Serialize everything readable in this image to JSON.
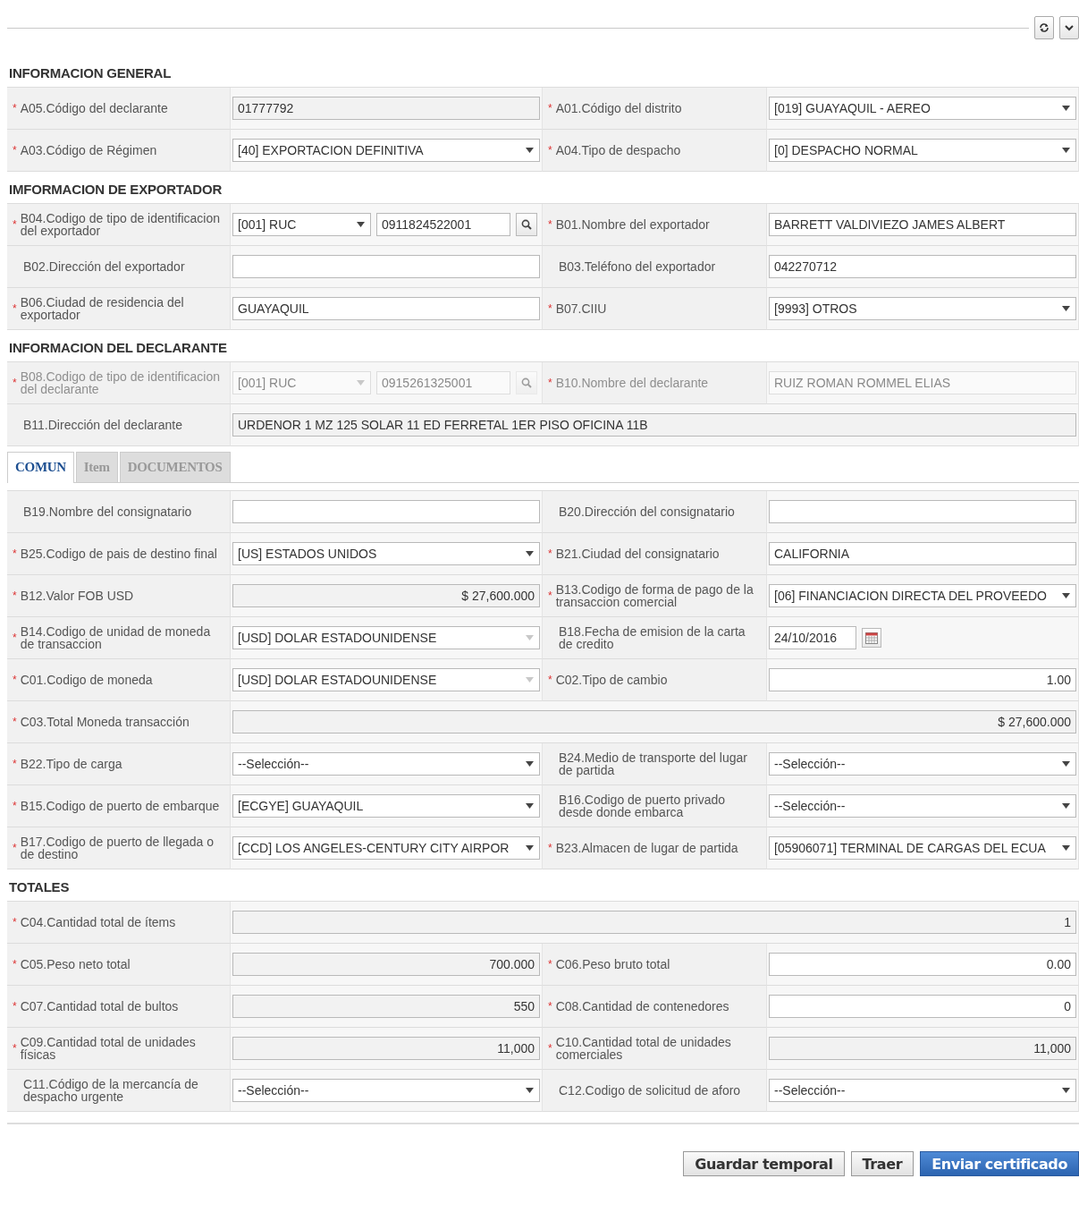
{
  "sections": [
    {
      "title": "INFORMACION GENERAL",
      "rows": [
        {
          "cells": [
            {
              "mark": "*",
              "label": "A05.Código del declarante",
              "field": {
                "kind": "text",
                "value": "01777792",
                "readonly": true
              }
            },
            {
              "mark": "*",
              "label": "A01.Código del distrito",
              "field": {
                "kind": "select",
                "value": "[019] GUAYAQUIL - AEREO"
              }
            }
          ]
        },
        {
          "cells": [
            {
              "mark": "*",
              "label": "A03.Código de Régimen",
              "field": {
                "kind": "select",
                "value": "[40] EXPORTACION DEFINITIVA"
              }
            },
            {
              "mark": "*",
              "label": "A04.Tipo de despacho",
              "field": {
                "kind": "select",
                "value": "[0] DESPACHO NORMAL"
              }
            }
          ]
        }
      ]
    },
    {
      "title": "IMFORMACION DE EXPORTADOR",
      "rows": [
        {
          "cells": [
            {
              "mark": "*",
              "label": "B04.Codigo de tipo de identificacion del exportador",
              "field": {
                "kind": "id",
                "option": "[001] RUC",
                "value": "0911824522001"
              }
            },
            {
              "mark": "*",
              "label": "B01.Nombre del exportador",
              "field": {
                "kind": "text",
                "value": "BARRETT VALDIVIEZO JAMES ALBERT"
              }
            }
          ]
        },
        {
          "cells": [
            {
              "label": "B02.Dirección del exportador",
              "field": {
                "kind": "text"
              }
            },
            {
              "label": "B03.Teléfono del exportador",
              "field": {
                "kind": "text",
                "value": "042270712"
              }
            }
          ]
        },
        {
          "cells": [
            {
              "mark": "*",
              "label": "B06.Ciudad de residencia del exportador",
              "field": {
                "kind": "text",
                "value": "GUAYAQUIL"
              }
            },
            {
              "mark": "*",
              "label": "B07.CIIU",
              "field": {
                "kind": "select",
                "value": "[9993] OTROS"
              }
            }
          ]
        }
      ]
    },
    {
      "title": "INFORMACION DEL DECLARANTE",
      "rows": [
        {
          "cells": [
            {
              "mark": "*",
              "label": "B08.Codigo de tipo de identificacion del declarante",
              "disabled": true,
              "field": {
                "kind": "id",
                "option": "[001] RUC",
                "value": "0915261325001",
                "disabled": true
              }
            },
            {
              "mark": "*",
              "label": "B10.Nombre del declarante",
              "disabled": true,
              "field": {
                "kind": "text",
                "value": "RUIZ ROMAN ROMMEL ELIAS",
                "disabled": true
              }
            }
          ]
        },
        {
          "cells": [
            {
              "label": "B11.Dirección del declarante",
              "wide": true,
              "field": {
                "kind": "text",
                "value": "URDENOR 1 MZ 125 SOLAR 11 ED FERRETAL 1ER PISO OFICINA 11B",
                "readonly": true
              }
            }
          ]
        }
      ]
    }
  ],
  "tabs": [
    {
      "label": "COMUN",
      "selected": true
    },
    {
      "label": "Item",
      "selected": false
    },
    {
      "label": "DOCUMENTOS",
      "selected": false
    }
  ],
  "tab_sections": [
    {
      "rows": [
        {
          "cells": [
            {
              "label": "B19.Nombre del consignatario",
              "field": {
                "kind": "text"
              }
            },
            {
              "label": "B20.Dirección del consignatario",
              "field": {
                "kind": "text"
              }
            }
          ]
        },
        {
          "cells": [
            {
              "mark": "*",
              "label": "B25.Codigo de pais de destino final",
              "field": {
                "kind": "select",
                "value": "[US] ESTADOS UNIDOS"
              }
            },
            {
              "mark": "*",
              "label": "B21.Ciudad del consignatario",
              "field": {
                "kind": "text",
                "value": "CALIFORNIA"
              }
            }
          ]
        },
        {
          "cells": [
            {
              "mark": "*",
              "label": "B12.Valor FOB USD",
              "field": {
                "kind": "number",
                "value": "$ 27,600.000",
                "readonly": true
              }
            },
            {
              "mark": "*",
              "label": "B13.Codigo de forma de pago de la transaccion comercial",
              "field": {
                "kind": "select",
                "value": "[06] FINANCIACION DIRECTA DEL PROVEEDO"
              }
            }
          ]
        },
        {
          "cells": [
            {
              "mark": "*",
              "label": "B14.Codigo de unidad de moneda de transaccion",
              "field": {
                "kind": "select",
                "value": "[USD] DOLAR ESTADOUNIDENSE",
                "readonly": true
              }
            },
            {
              "label": "B18.Fecha de emision de la carta de credito",
              "field": {
                "kind": "date",
                "value": "24/10/2016"
              }
            }
          ]
        },
        {
          "cells": [
            {
              "mark": "*",
              "label": "C01.Codigo de moneda",
              "field": {
                "kind": "select",
                "value": "[USD] DOLAR ESTADOUNIDENSE",
                "readonly": true
              }
            },
            {
              "mark": "*",
              "label": "C02.Tipo de cambio",
              "field": {
                "kind": "number",
                "value": "1.00"
              }
            }
          ]
        },
        {
          "cells": [
            {
              "mark": "*",
              "label": "C03.Total Moneda transacción",
              "wide": true,
              "field": {
                "kind": "number",
                "value": "$ 27,600.000",
                "readonly": true
              }
            }
          ]
        },
        {
          "cells": [
            {
              "mark": "*",
              "label": "B22.Tipo de carga",
              "field": {
                "kind": "select",
                "value": "--Selección--"
              }
            },
            {
              "label": "B24.Medio de transporte del lugar de partida",
              "field": {
                "kind": "select",
                "value": "--Selección--"
              }
            }
          ]
        },
        {
          "cells": [
            {
              "mark": "*",
              "label": "B15.Codigo de puerto de embarque",
              "field": {
                "kind": "select",
                "value": "[ECGYE] GUAYAQUIL"
              }
            },
            {
              "label": "B16.Codigo de puerto privado desde donde embarca",
              "field": {
                "kind": "select",
                "value": "--Selección--"
              }
            }
          ]
        },
        {
          "cells": [
            {
              "mark": "*",
              "label": "B17.Codigo de puerto de llegada o de destino",
              "field": {
                "kind": "select",
                "value": "[CCD] LOS ANGELES-CENTURY CITY AIRPOR"
              }
            },
            {
              "mark": "*",
              "label": "B23.Almacen de lugar de partida",
              "field": {
                "kind": "select",
                "value": "[05906071] TERMINAL DE CARGAS DEL ECUA"
              }
            }
          ]
        }
      ]
    },
    {
      "title": "TOTALES",
      "rows": [
        {
          "cells": [
            {
              "mark": "*",
              "label": "C04.Cantidad total de ítems",
              "wide": true,
              "field": {
                "kind": "number",
                "value": "1",
                "readonly": true
              }
            }
          ]
        },
        {
          "cells": [
            {
              "mark": "*",
              "label": "C05.Peso neto total",
              "field": {
                "kind": "number",
                "value": "700.000",
                "readonly": true
              }
            },
            {
              "mark": "*",
              "label": "C06.Peso bruto total",
              "field": {
                "kind": "number",
                "value": "0.00"
              }
            }
          ]
        },
        {
          "cells": [
            {
              "mark": "*",
              "label": "C07.Cantidad total de bultos",
              "field": {
                "kind": "number",
                "value": "550",
                "readonly": true
              }
            },
            {
              "mark": "*",
              "label": "C08.Cantidad de contenedores",
              "field": {
                "kind": "number",
                "value": "0"
              }
            }
          ]
        },
        {
          "cells": [
            {
              "mark": "*",
              "label": "C09.Cantidad total de unidades físicas",
              "field": {
                "kind": "number",
                "value": "11,000",
                "readonly": true
              }
            },
            {
              "mark": "*",
              "label": "C10.Cantidad total de unidades comerciales",
              "field": {
                "kind": "number",
                "value": "11,000",
                "readonly": true
              }
            }
          ]
        },
        {
          "cells": [
            {
              "label": "C11.Código de la mercancía de despacho urgente",
              "field": {
                "kind": "select",
                "value": "--Selección--"
              }
            },
            {
              "label": "C12.Codigo de solicitud de aforo",
              "field": {
                "kind": "select",
                "value": "--Selección--"
              }
            }
          ]
        }
      ]
    }
  ],
  "buttons": [
    {
      "label": "Guardar temporal",
      "kind": "default"
    },
    {
      "label": "Traer",
      "kind": "default"
    },
    {
      "label": "Enviar certificado",
      "kind": "primary"
    }
  ]
}
